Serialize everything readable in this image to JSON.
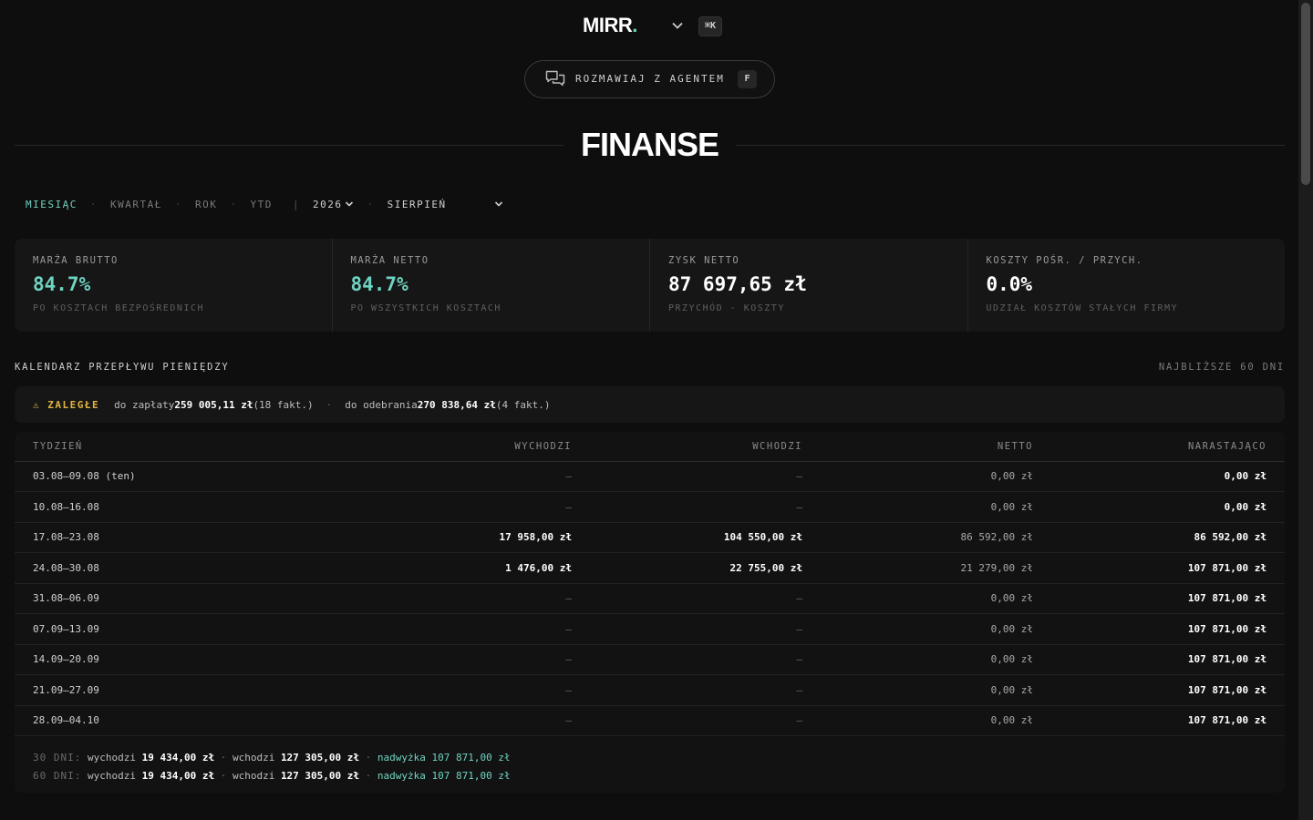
{
  "header": {
    "logo_text": "MIRR",
    "logo_dot": ".",
    "shortcut": "⌘K"
  },
  "agent_button": {
    "label": "ROZMAWIAJ Z AGENTEM",
    "shortcut": "F"
  },
  "page_title": "FINANSE",
  "period": {
    "options": [
      "MIESIĄC",
      "KWARTAŁ",
      "ROK",
      "YTD"
    ],
    "active": "MIESIĄC",
    "separator": "·",
    "divider": "|",
    "year": "2026",
    "month": "SIERPIEŃ"
  },
  "kpis": [
    {
      "label": "MARŻA BRUTTO",
      "value": "84.7%",
      "sub": "PO KOSZTACH BEZPOŚREDNICH",
      "accent": true
    },
    {
      "label": "MARŻA NETTO",
      "value": "84.7%",
      "sub": "PO WSZYSTKICH KOSZTACH",
      "accent": true
    },
    {
      "label": "ZYSK NETTO",
      "value": "87 697,65 zł",
      "sub": "PRZYCHÓD - KOSZTY",
      "accent": false
    },
    {
      "label": "KOSZTY POŚR. / PRZYCH.",
      "value": "0.0%",
      "sub": "UDZIAŁ KOSZTÓW STAŁYCH FIRMY",
      "accent": false
    }
  ],
  "cashflow": {
    "title": "KALENDARZ PRZEPŁYWU PIENIĘDZY",
    "range": "NAJBLIŻSZE 60 DNI",
    "overdue": {
      "label": "⚠ ZALEGŁE",
      "pay_label": "do zapłaty",
      "pay_amount": "259 005,11 zł",
      "pay_count": "(18 fakt.)",
      "dot": "·",
      "receive_label": "do odebrania",
      "receive_amount": "270 838,64 zł",
      "receive_count": "(4 fakt.)"
    },
    "columns": [
      "TYDZIEŃ",
      "WYCHODZI",
      "WCHODZI",
      "NETTO",
      "NARASTAJĄCO"
    ],
    "rows": [
      {
        "week": "03.08–09.08 (ten)",
        "out": "—",
        "in": "—",
        "net": "0,00 zł",
        "cum": "0,00 zł"
      },
      {
        "week": "10.08–16.08",
        "out": "—",
        "in": "—",
        "net": "0,00 zł",
        "cum": "0,00 zł"
      },
      {
        "week": "17.08–23.08",
        "out": "17 958,00 zł",
        "in": "104 550,00 zł",
        "net": "86 592,00 zł",
        "cum": "86 592,00 zł"
      },
      {
        "week": "24.08–30.08",
        "out": "1 476,00 zł",
        "in": "22 755,00 zł",
        "net": "21 279,00 zł",
        "cum": "107 871,00 zł"
      },
      {
        "week": "31.08–06.09",
        "out": "—",
        "in": "—",
        "net": "0,00 zł",
        "cum": "107 871,00 zł"
      },
      {
        "week": "07.09–13.09",
        "out": "—",
        "in": "—",
        "net": "0,00 zł",
        "cum": "107 871,00 zł"
      },
      {
        "week": "14.09–20.09",
        "out": "—",
        "in": "—",
        "net": "0,00 zł",
        "cum": "107 871,00 zł"
      },
      {
        "week": "21.09–27.09",
        "out": "—",
        "in": "—",
        "net": "0,00 zł",
        "cum": "107 871,00 zł"
      },
      {
        "week": "28.09–04.10",
        "out": "—",
        "in": "—",
        "net": "0,00 zł",
        "cum": "107 871,00 zł"
      }
    ],
    "summary": [
      {
        "label": "30 DNI:",
        "out_label": "wychodzi",
        "out": "19 434,00 zł",
        "sep": "·",
        "in_label": "wchodzi",
        "in": "127 305,00 zł",
        "surplus_label": "nadwyżka",
        "surplus": "107 871,00 zł"
      },
      {
        "label": "60 DNI:",
        "out_label": "wychodzi",
        "out": "19 434,00 zł",
        "sep": "·",
        "in_label": "wchodzi",
        "in": "127 305,00 zł",
        "surplus_label": "nadwyżka",
        "surplus": "107 871,00 zł"
      }
    ]
  },
  "colors": {
    "accent": "#6fd3c1",
    "warning": "#e2b340",
    "background": "#0e0e0e",
    "card": "#161616"
  }
}
